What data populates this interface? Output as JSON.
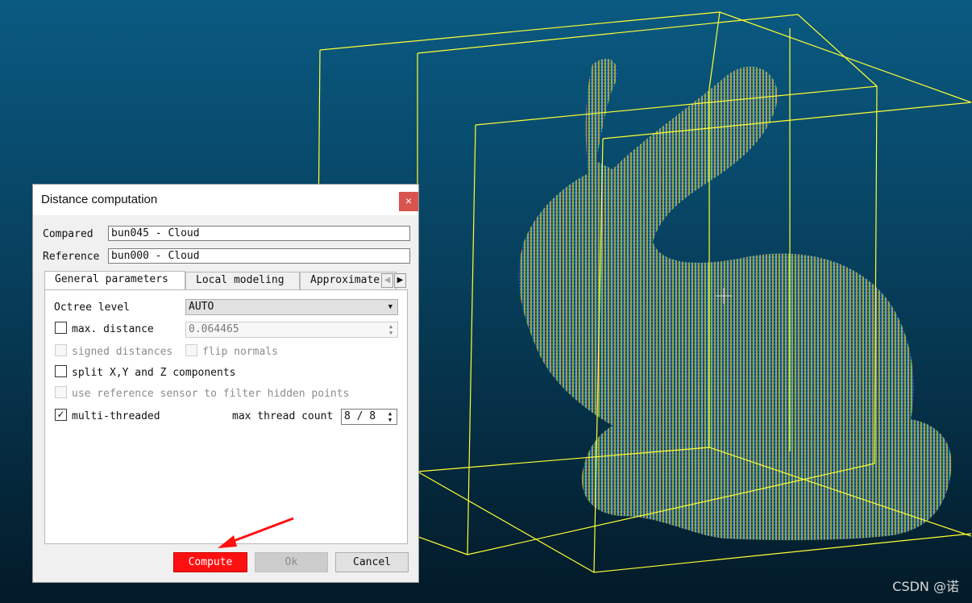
{
  "viewport": {
    "background_top": "#0a5a82",
    "background_bottom": "#031a28",
    "bbox_color": "#ffff33",
    "watermark": "CSDN @诺"
  },
  "dialog": {
    "title": "Distance computation",
    "close_icon": "×",
    "compared_label": "Compared",
    "compared_value": "bun045 - Cloud",
    "reference_label": "Reference",
    "reference_value": "bun000 - Cloud",
    "tabs": [
      {
        "label": "General parameters",
        "active": true
      },
      {
        "label": "Local modeling",
        "active": false
      },
      {
        "label": "Approximate",
        "active": false
      }
    ],
    "tab_scroll_left": "◀",
    "tab_scroll_right": "▶",
    "octree_label": "Octree level",
    "octree_value": "AUTO",
    "max_distance_label": "max. distance",
    "max_distance_value": "0.064465",
    "max_distance_checked": false,
    "signed_distances_label": "signed distances",
    "flip_normals_label": "flip normals",
    "split_label": "split X,Y and Z components",
    "split_checked": false,
    "use_sensor_label": "use reference sensor to filter hidden points",
    "multi_threaded_label": "multi-threaded",
    "multi_threaded_checked": true,
    "check_mark": "✓",
    "max_thread_label": "max thread count",
    "max_thread_value": "8 / 8",
    "compute_label": "Compute",
    "ok_label": "Ok",
    "cancel_label": "Cancel",
    "highlight_color": "#ff1010"
  }
}
